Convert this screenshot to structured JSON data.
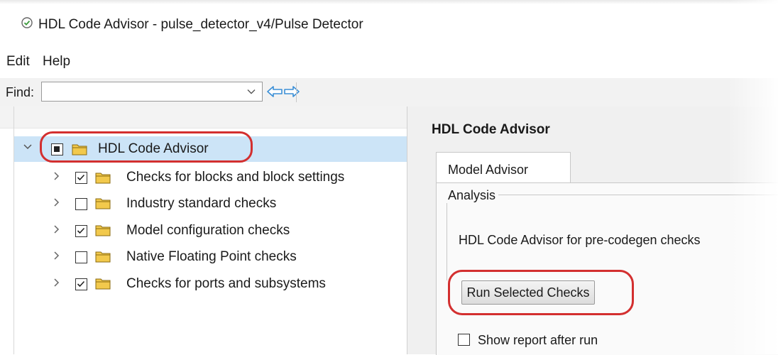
{
  "window": {
    "title": "HDL Code Advisor - pulse_detector_v4/Pulse Detector",
    "title_icon": "check-circle-icon"
  },
  "menu": {
    "items": [
      {
        "label": "Edit"
      },
      {
        "label": "Help"
      }
    ]
  },
  "toolbar": {
    "find_label": "Find:",
    "find_value": "",
    "find_placeholder": "",
    "back_icon": "arrow-left-icon",
    "forward_icon": "arrow-right-icon"
  },
  "tree": {
    "root": {
      "label": "HDL Code Advisor",
      "check_state": "partial",
      "expanded": true,
      "selected": true,
      "highlighted": true
    },
    "children": [
      {
        "label": "Checks for blocks and block settings",
        "checked": true
      },
      {
        "label": "Industry standard checks",
        "checked": false
      },
      {
        "label": "Model configuration checks",
        "checked": true
      },
      {
        "label": "Native Floating Point checks",
        "checked": false
      },
      {
        "label": "Checks for ports and subsystems",
        "checked": true
      }
    ]
  },
  "details": {
    "title": "HDL Code Advisor",
    "tab_label": "Model Advisor",
    "group_label": "Analysis",
    "description": "HDL Code Advisor for pre-codegen checks",
    "run_button_label": "Run Selected Checks",
    "run_button_highlighted": true,
    "show_report_label": "Show report after run",
    "show_report_checked": false
  },
  "colors": {
    "highlight_ring": "#d32f2f",
    "selection": "#cce4f7",
    "folder": "#f2c94c",
    "arrow": "#3b8fd6"
  }
}
